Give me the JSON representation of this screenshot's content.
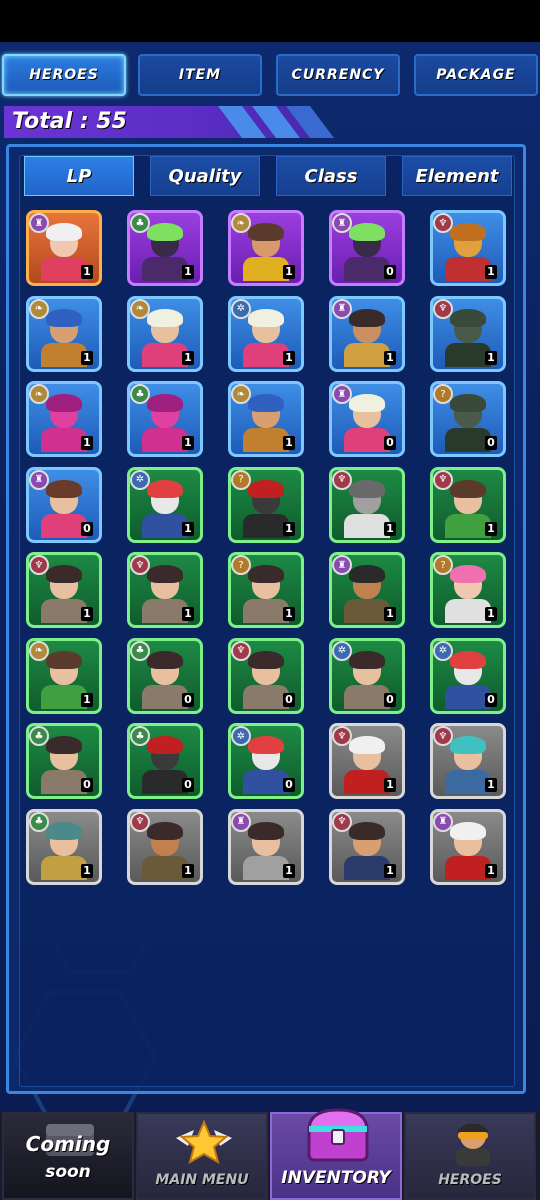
{
  "top_tabs": [
    "HEROES",
    "ITEM",
    "CURRENCY",
    "PACKAGE"
  ],
  "total_label": "Total : 55",
  "filter_tabs": [
    "LP",
    "Quality",
    "Class",
    "Element"
  ],
  "colors": {
    "accent": "#7fd8ff",
    "panel_border": "#3a86e0",
    "total_bar": "#6b34d6"
  },
  "heroes": [
    {
      "rarity": "orange",
      "level": "1",
      "badge": "tank-icon",
      "skin": "#f0c8b0",
      "hair": "#f0f0f0",
      "outfit": "#e04060"
    },
    {
      "rarity": "purple",
      "level": "1",
      "badge": "leaf-icon",
      "skin": "#3a2a4a",
      "hair": "#7de060",
      "outfit": "#4a2a6a"
    },
    {
      "rarity": "purple",
      "level": "1",
      "badge": "feather-icon",
      "skin": "#d89a6a",
      "hair": "#5a3a2a",
      "outfit": "#e0b020"
    },
    {
      "rarity": "purple",
      "level": "0",
      "badge": "tank-icon",
      "skin": "#3a2a4a",
      "hair": "#7de060",
      "outfit": "#4a2a6a"
    },
    {
      "rarity": "blue",
      "level": "1",
      "badge": "demon-icon",
      "skin": "#e0a040",
      "hair": "#c07020",
      "outfit": "#c03030"
    },
    {
      "rarity": "blue",
      "level": "1",
      "badge": "feather-icon",
      "skin": "#d8a070",
      "hair": "#3060c0",
      "outfit": "#c08030"
    },
    {
      "rarity": "blue",
      "level": "1",
      "badge": "feather-icon",
      "skin": "#e8c0a0",
      "hair": "#f0f0e0",
      "outfit": "#e0407a"
    },
    {
      "rarity": "blue",
      "level": "1",
      "badge": "gear-icon",
      "skin": "#e8c0a0",
      "hair": "#f0f0e0",
      "outfit": "#e0407a"
    },
    {
      "rarity": "blue",
      "level": "1",
      "badge": "tank-icon",
      "skin": "#c89060",
      "hair": "#3a2a2a",
      "outfit": "#d0a040"
    },
    {
      "rarity": "blue",
      "level": "1",
      "badge": "demon-icon",
      "skin": "#4a5a4a",
      "hair": "#3a4a3a",
      "outfit": "#2a3a2a"
    },
    {
      "rarity": "blue",
      "level": "1",
      "badge": "feather-icon",
      "skin": "#e040a0",
      "hair": "#a02080",
      "outfit": "#d03090"
    },
    {
      "rarity": "blue",
      "level": "1",
      "badge": "leaf-icon",
      "skin": "#e040a0",
      "hair": "#a02080",
      "outfit": "#d03090"
    },
    {
      "rarity": "blue",
      "level": "1",
      "badge": "feather-icon",
      "skin": "#d8a070",
      "hair": "#3060c0",
      "outfit": "#c08030"
    },
    {
      "rarity": "blue",
      "level": "0",
      "badge": "tank-icon",
      "skin": "#e8c0a0",
      "hair": "#f0f0e0",
      "outfit": "#e0407a"
    },
    {
      "rarity": "blue",
      "level": "0",
      "badge": "question-icon",
      "skin": "#4a5a4a",
      "hair": "#3a4a3a",
      "outfit": "#2a3a2a"
    },
    {
      "rarity": "blue",
      "level": "0",
      "badge": "tank-icon",
      "skin": "#e8c0a0",
      "hair": "#6a3a2a",
      "outfit": "#e0407a"
    },
    {
      "rarity": "green",
      "level": "1",
      "badge": "gear-icon",
      "skin": "#e8e8e8",
      "hair": "#e04040",
      "outfit": "#3050a0"
    },
    {
      "rarity": "green",
      "level": "1",
      "badge": "question-icon",
      "skin": "#3a3a3a",
      "hair": "#c02020",
      "outfit": "#2a2a2a"
    },
    {
      "rarity": "green",
      "level": "1",
      "badge": "demon-icon",
      "skin": "#a0a0a0",
      "hair": "#6a6a6a",
      "outfit": "#e0e0e0"
    },
    {
      "rarity": "green",
      "level": "1",
      "badge": "demon-icon",
      "skin": "#e8c0a0",
      "hair": "#5a3a2a",
      "outfit": "#40a040"
    },
    {
      "rarity": "green",
      "level": "1",
      "badge": "demon-icon",
      "skin": "#e8c0a0",
      "hair": "#3a2a2a",
      "outfit": "#8a7a6a"
    },
    {
      "rarity": "green",
      "level": "1",
      "badge": "demon-icon",
      "skin": "#e8c0a0",
      "hair": "#3a2a2a",
      "outfit": "#8a7a6a"
    },
    {
      "rarity": "green",
      "level": "1",
      "badge": "question-icon",
      "skin": "#e8c0a0",
      "hair": "#3a2a2a",
      "outfit": "#8a7a6a"
    },
    {
      "rarity": "green",
      "level": "1",
      "badge": "tank-icon",
      "skin": "#c08050",
      "hair": "#2a2a2a",
      "outfit": "#6a5a3a"
    },
    {
      "rarity": "green",
      "level": "1",
      "badge": "question-icon",
      "skin": "#f0c8b0",
      "hair": "#f070b0",
      "outfit": "#e0e0e0"
    },
    {
      "rarity": "green",
      "level": "1",
      "badge": "feather-icon",
      "skin": "#e8c0a0",
      "hair": "#5a3a2a",
      "outfit": "#40a040"
    },
    {
      "rarity": "green",
      "level": "0",
      "badge": "leaf-icon",
      "skin": "#e8c0a0",
      "hair": "#3a2a2a",
      "outfit": "#8a7a6a"
    },
    {
      "rarity": "green",
      "level": "0",
      "badge": "demon-icon",
      "skin": "#e8c0a0",
      "hair": "#3a2a2a",
      "outfit": "#8a7a6a"
    },
    {
      "rarity": "green",
      "level": "0",
      "badge": "gear-icon",
      "skin": "#e8c0a0",
      "hair": "#3a2a2a",
      "outfit": "#8a7a6a"
    },
    {
      "rarity": "green",
      "level": "0",
      "badge": "gear-icon",
      "skin": "#e8e8e8",
      "hair": "#e04040",
      "outfit": "#3050a0"
    },
    {
      "rarity": "green",
      "level": "0",
      "badge": "leaf-icon",
      "skin": "#e8c0a0",
      "hair": "#3a2a2a",
      "outfit": "#8a7a6a"
    },
    {
      "rarity": "green",
      "level": "0",
      "badge": "leaf-icon",
      "skin": "#3a3a3a",
      "hair": "#c02020",
      "outfit": "#2a2a2a"
    },
    {
      "rarity": "green",
      "level": "0",
      "badge": "gear-icon",
      "skin": "#e8e8e8",
      "hair": "#e04040",
      "outfit": "#3050a0"
    },
    {
      "rarity": "gray",
      "level": "1",
      "badge": "demon-icon",
      "skin": "#e8c0a0",
      "hair": "#f0f0f0",
      "outfit": "#c02020"
    },
    {
      "rarity": "gray",
      "level": "1",
      "badge": "demon-icon",
      "skin": "#e8c0a0",
      "hair": "#40c0c0",
      "outfit": "#3a6aa0"
    },
    {
      "rarity": "gray",
      "level": "1",
      "badge": "leaf-icon",
      "skin": "#e8c0a0",
      "hair": "#4a8a8a",
      "outfit": "#c0a040"
    },
    {
      "rarity": "gray",
      "level": "1",
      "badge": "demon-icon",
      "skin": "#c08050",
      "hair": "#3a2a2a",
      "outfit": "#6a5a3a"
    },
    {
      "rarity": "gray",
      "level": "1",
      "badge": "tank-icon",
      "skin": "#e8c0a0",
      "hair": "#3a2a2a",
      "outfit": "#a0a0a0"
    },
    {
      "rarity": "gray",
      "level": "1",
      "badge": "demon-icon",
      "skin": "#d8a070",
      "hair": "#3a2a2a",
      "outfit": "#2a3a6a"
    },
    {
      "rarity": "gray",
      "level": "1",
      "badge": "tank-icon",
      "skin": "#e8c0a0",
      "hair": "#f0f0f0",
      "outfit": "#c02020"
    }
  ],
  "bottom_nav": {
    "coming_top": "Coming",
    "coming_bottom": "soon",
    "main_menu": "MAIN MENU",
    "inventory": "INVENTORY",
    "heroes": "HEROES"
  }
}
